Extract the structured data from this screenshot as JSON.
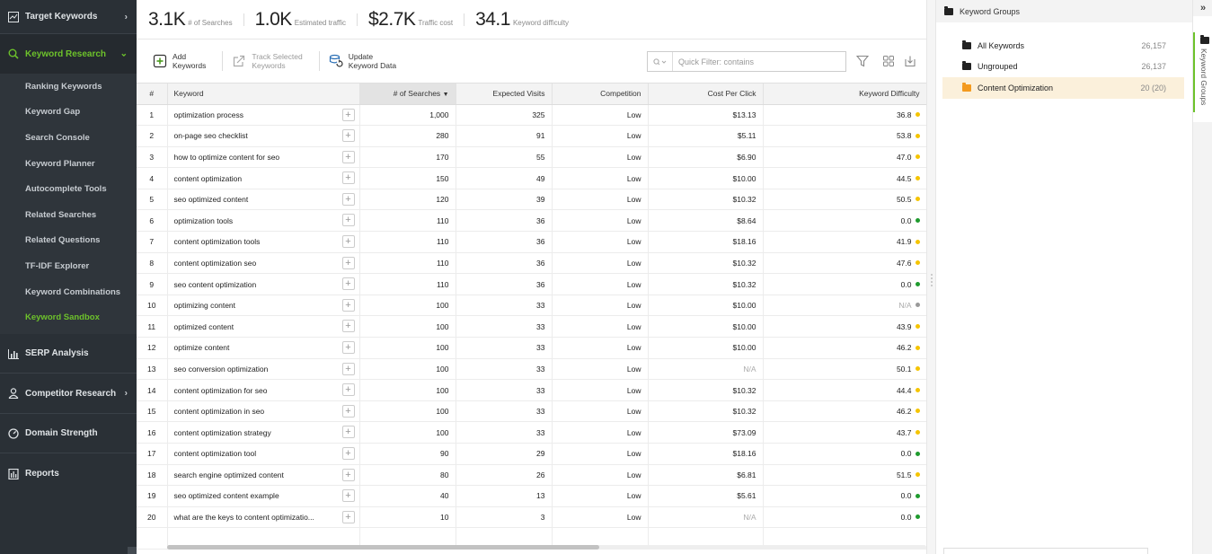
{
  "sidebar": {
    "target_keywords": "Target Keywords",
    "keyword_research": "Keyword Research",
    "subitems": [
      "Ranking Keywords",
      "Keyword Gap",
      "Search Console",
      "Keyword Planner",
      "Autocomplete Tools",
      "Related Searches",
      "Related Questions",
      "TF-IDF Explorer",
      "Keyword Combinations",
      "Keyword Sandbox"
    ],
    "active_subitem": "Keyword Sandbox",
    "serp_analysis": "SERP Analysis",
    "competitor_research": "Competitor Research",
    "domain_strength": "Domain Strength",
    "reports": "Reports",
    "accent_color": "#6dc22b"
  },
  "stats": [
    {
      "value": "3.1K",
      "label": "# of Searches"
    },
    {
      "value": "1.0K",
      "label": "Estimated traffic"
    },
    {
      "value": "$2.7K",
      "label": "Traffic cost"
    },
    {
      "value": "34.1",
      "label": "Keyword difficulty"
    }
  ],
  "toolbar": {
    "add_line1": "Add",
    "add_line2": "Keywords",
    "track_line1": "Track Selected",
    "track_line2": "Keywords",
    "update_line1": "Update",
    "update_line2": "Keyword Data",
    "filter_placeholder": "Quick Filter: contains"
  },
  "table": {
    "columns": [
      "#",
      "Keyword",
      "# of Searches",
      "Expected Visits",
      "Competition",
      "Cost Per Click",
      "Keyword Difficulty"
    ],
    "sort_indicator": "▼",
    "rows": [
      {
        "n": "1",
        "kw": "optimization process",
        "searches": "1,000",
        "visits": "325",
        "comp": "Low",
        "cpc": "$13.13",
        "kd": "36.8",
        "kd_color": "#f5c400"
      },
      {
        "n": "2",
        "kw": "on-page seo checklist",
        "searches": "280",
        "visits": "91",
        "comp": "Low",
        "cpc": "$5.11",
        "kd": "53.8",
        "kd_color": "#f5c400"
      },
      {
        "n": "3",
        "kw": "how to optimize content for seo",
        "searches": "170",
        "visits": "55",
        "comp": "Low",
        "cpc": "$6.90",
        "kd": "47.0",
        "kd_color": "#f5c400"
      },
      {
        "n": "4",
        "kw": "content optimization",
        "searches": "150",
        "visits": "49",
        "comp": "Low",
        "cpc": "$10.00",
        "kd": "44.5",
        "kd_color": "#f5c400"
      },
      {
        "n": "5",
        "kw": "seo optimized content",
        "searches": "120",
        "visits": "39",
        "comp": "Low",
        "cpc": "$10.32",
        "kd": "50.5",
        "kd_color": "#f5c400"
      },
      {
        "n": "6",
        "kw": "optimization tools",
        "searches": "110",
        "visits": "36",
        "comp": "Low",
        "cpc": "$8.64",
        "kd": "0.0",
        "kd_color": "#1f9b2e"
      },
      {
        "n": "7",
        "kw": "content optimization tools",
        "searches": "110",
        "visits": "36",
        "comp": "Low",
        "cpc": "$18.16",
        "kd": "41.9",
        "kd_color": "#f5c400"
      },
      {
        "n": "8",
        "kw": "content optimization seo",
        "searches": "110",
        "visits": "36",
        "comp": "Low",
        "cpc": "$10.32",
        "kd": "47.6",
        "kd_color": "#f5c400"
      },
      {
        "n": "9",
        "kw": "seo content optimization",
        "searches": "110",
        "visits": "36",
        "comp": "Low",
        "cpc": "$10.32",
        "kd": "0.0",
        "kd_color": "#1f9b2e"
      },
      {
        "n": "10",
        "kw": "optimizing content",
        "searches": "100",
        "visits": "33",
        "comp": "Low",
        "cpc": "$10.00",
        "kd": "N/A",
        "kd_color": "#999999"
      },
      {
        "n": "11",
        "kw": "optimized content",
        "searches": "100",
        "visits": "33",
        "comp": "Low",
        "cpc": "$10.00",
        "kd": "43.9",
        "kd_color": "#f5c400"
      },
      {
        "n": "12",
        "kw": "optimize content",
        "searches": "100",
        "visits": "33",
        "comp": "Low",
        "cpc": "$10.00",
        "kd": "46.2",
        "kd_color": "#f5c400"
      },
      {
        "n": "13",
        "kw": "seo conversion optimization",
        "searches": "100",
        "visits": "33",
        "comp": "Low",
        "cpc": "N/A",
        "kd": "50.1",
        "kd_color": "#f5c400"
      },
      {
        "n": "14",
        "kw": "content optimization for seo",
        "searches": "100",
        "visits": "33",
        "comp": "Low",
        "cpc": "$10.32",
        "kd": "44.4",
        "kd_color": "#f5c400"
      },
      {
        "n": "15",
        "kw": "content optimization in seo",
        "searches": "100",
        "visits": "33",
        "comp": "Low",
        "cpc": "$10.32",
        "kd": "46.2",
        "kd_color": "#f5c400"
      },
      {
        "n": "16",
        "kw": "content optimization strategy",
        "searches": "100",
        "visits": "33",
        "comp": "Low",
        "cpc": "$73.09",
        "kd": "43.7",
        "kd_color": "#f5c400"
      },
      {
        "n": "17",
        "kw": "content optimization tool",
        "searches": "90",
        "visits": "29",
        "comp": "Low",
        "cpc": "$18.16",
        "kd": "0.0",
        "kd_color": "#1f9b2e"
      },
      {
        "n": "18",
        "kw": "search engine optimized content",
        "searches": "80",
        "visits": "26",
        "comp": "Low",
        "cpc": "$6.81",
        "kd": "51.5",
        "kd_color": "#f5c400"
      },
      {
        "n": "19",
        "kw": "seo optimized content example",
        "searches": "40",
        "visits": "13",
        "comp": "Low",
        "cpc": "$5.61",
        "kd": "0.0",
        "kd_color": "#1f9b2e"
      },
      {
        "n": "20",
        "kw": "what are the keys to content optimizatio...",
        "searches": "10",
        "visits": "3",
        "comp": "Low",
        "cpc": "N/A",
        "kd": "0.0",
        "kd_color": "#1f9b2e"
      }
    ]
  },
  "groups": {
    "header": "Keyword Groups",
    "items": [
      {
        "label": "All Keywords",
        "count": "26,157",
        "active": false
      },
      {
        "label": "Ungrouped",
        "count": "26,137",
        "active": false
      },
      {
        "label": "Content Optimization",
        "count": "20 (20)",
        "active": true
      }
    ],
    "vertical_tab": "Keyword Groups",
    "expand_glyph": "»"
  }
}
